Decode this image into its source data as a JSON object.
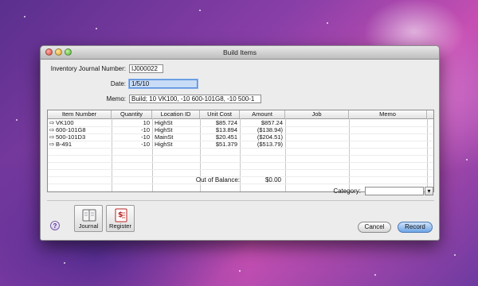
{
  "window": {
    "title": "Build Items"
  },
  "form": {
    "journal_label": "Inventory Journal Number:",
    "journal_value": "IJ000022",
    "date_label": "Date:",
    "date_value": "1/5/10",
    "memo_label": "Memo:",
    "memo_value": "Build; 10 VK100, -10 600-101G8, -10 500-1"
  },
  "table": {
    "headers": [
      "Item Number",
      "Quantity",
      "Location ID",
      "Unit Cost",
      "Amount",
      "Job",
      "Memo"
    ],
    "rows": [
      {
        "arrow": "⇨",
        "item": "VK100",
        "qty": "10",
        "loc": "HighSt",
        "cost": "$85.724",
        "amount": "$857.24"
      },
      {
        "arrow": "⇨",
        "item": "600-101G8",
        "qty": "-10",
        "loc": "HighSt",
        "cost": "$13.894",
        "amount": "($138.94)"
      },
      {
        "arrow": "⇨",
        "item": "500-101D3",
        "qty": "-10",
        "loc": "MainSt",
        "cost": "$20.451",
        "amount": "($204.51)"
      },
      {
        "arrow": "⇨",
        "item": "B-491",
        "qty": "-10",
        "loc": "HighSt",
        "cost": "$51.379",
        "amount": "($513.79)"
      }
    ]
  },
  "balance": {
    "label": "Out of Balance:",
    "value": "$0.00"
  },
  "category": {
    "label": "Category:",
    "value": ""
  },
  "toolbar": {
    "journal": "Journal",
    "register": "Register",
    "help": "?"
  },
  "actions": {
    "cancel": "Cancel",
    "record": "Record"
  },
  "colors": {
    "accent": "#6fa5e6",
    "window_bg": "#ececec"
  }
}
